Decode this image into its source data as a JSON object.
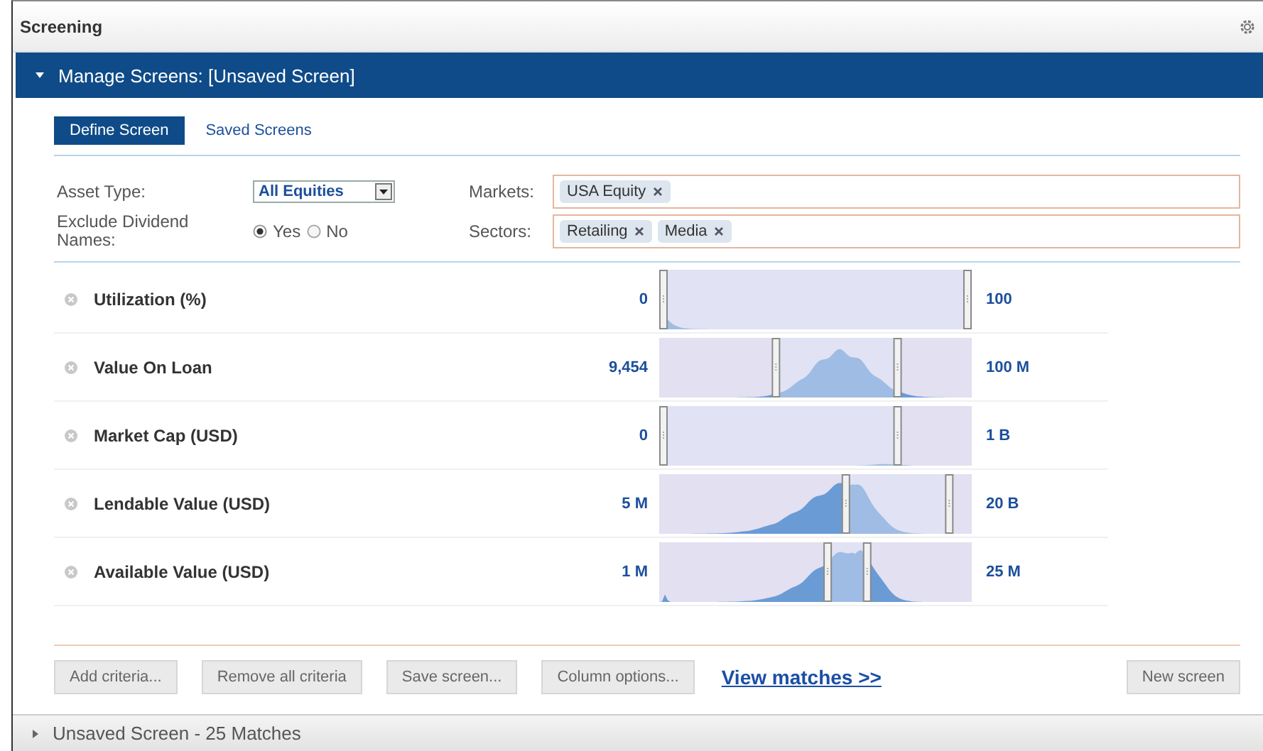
{
  "window": {
    "title": "Screening"
  },
  "panel": {
    "title": "Manage Screens: [Unsaved Screen]",
    "expanded": true
  },
  "tabs": [
    {
      "label": "Define Screen",
      "selected": true
    },
    {
      "label": "Saved Screens",
      "selected": false
    }
  ],
  "filters": {
    "asset_type": {
      "label": "Asset Type:",
      "value": "All Equities"
    },
    "exclude_dividend": {
      "label": "Exclude Dividend Names:",
      "options": [
        {
          "label": "Yes",
          "selected": true
        },
        {
          "label": "No",
          "selected": false
        }
      ]
    },
    "markets": {
      "label": "Markets:",
      "tags": [
        "USA Equity"
      ]
    },
    "sectors": {
      "label": "Sectors:",
      "tags": [
        "Retailing",
        "Media"
      ]
    }
  },
  "criteria": [
    {
      "name": "Utilization (%)",
      "min": "0",
      "max": "100",
      "handles": [
        {
          "level": 0
        },
        {
          "level": 1
        }
      ]
    },
    {
      "name": "Value On Loan",
      "min": "9,454",
      "max": "100 M",
      "handles": [
        {
          "level": 0.37
        },
        {
          "level": 0.77
        }
      ]
    },
    {
      "name": "Market Cap (USD)",
      "min": "0",
      "max": "1 B",
      "handles": [
        {
          "level": 0
        },
        {
          "level": 0.77
        }
      ]
    },
    {
      "name": "Lendable Value (USD)",
      "min": "5 M",
      "max": "20 B",
      "handles": [
        {
          "level": 0.6
        },
        {
          "level": 0.94
        }
      ]
    },
    {
      "name": "Available Value (USD)",
      "min": "1 M",
      "max": "25 M",
      "handles": [
        {
          "level": 0.54
        },
        {
          "level": 0.67
        }
      ]
    }
  ],
  "actions": [
    "Add criteria...",
    "Remove all criteria",
    "Save screen...",
    "Column options..."
  ],
  "view_link": "View matches >>",
  "new_button": "New screen",
  "results_bar": {
    "title": "Unsaved Screen - 25 Matches",
    "expanded": false
  }
}
